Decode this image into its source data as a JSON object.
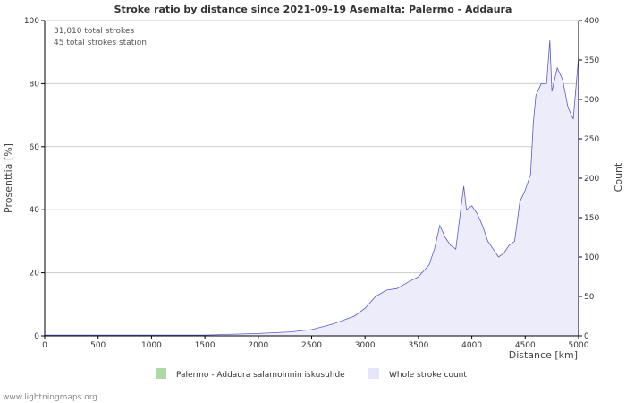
{
  "chart_data": {
    "type": "area",
    "title": "Stroke ratio by distance since 2021-09-19 Asemalta: Palermo - Addaura",
    "xlabel": "Distance   [km]",
    "ylabel_left": "Prosenttia   [%]",
    "ylabel_right": "Count",
    "xlim": [
      0,
      5000
    ],
    "ylim_left": [
      0,
      100
    ],
    "ylim_right": [
      0,
      400
    ],
    "x_ticks": [
      "0",
      "500",
      "1000",
      "1500",
      "2000",
      "2500",
      "3000",
      "3500",
      "4000",
      "4500",
      "5000"
    ],
    "y_left_ticks": [
      "0",
      "20",
      "40",
      "60",
      "80",
      "100"
    ],
    "y_right_ticks": [
      "0",
      "50",
      "100",
      "150",
      "200",
      "250",
      "300",
      "350",
      "400"
    ],
    "grid": true,
    "annotations": [
      "31,010 total strokes",
      "45 total strokes station"
    ],
    "legend": [
      {
        "name": "Palermo - Addaura salamoinnin iskusuhde",
        "color": "#aed9a6"
      },
      {
        "name": "Whole stroke count",
        "color": "#e6e6f8"
      }
    ],
    "series": [
      {
        "name": "Whole stroke count",
        "axis": "right",
        "x": [
          0,
          500,
          1000,
          1500,
          2000,
          2300,
          2500,
          2700,
          2800,
          2900,
          3000,
          3100,
          3200,
          3300,
          3400,
          3500,
          3600,
          3650,
          3700,
          3750,
          3800,
          3850,
          3900,
          3925,
          3950,
          4000,
          4050,
          4100,
          4150,
          4200,
          4250,
          4300,
          4350,
          4400,
          4450,
          4500,
          4550,
          4575,
          4600,
          4650,
          4700,
          4730,
          4750,
          4800,
          4850,
          4900,
          4950,
          5000
        ],
        "values": [
          1,
          1,
          1,
          1,
          3,
          5,
          8,
          15,
          20,
          25,
          35,
          50,
          58,
          60,
          68,
          75,
          90,
          110,
          140,
          125,
          115,
          110,
          165,
          190,
          160,
          165,
          155,
          140,
          120,
          110,
          100,
          105,
          115,
          120,
          170,
          185,
          205,
          270,
          305,
          320,
          320,
          375,
          310,
          340,
          325,
          290,
          275,
          355
        ]
      }
    ]
  },
  "footer": "www.lightningmaps.org",
  "colors": {
    "area_fill": "#ececfa",
    "line": "#5a5ad0",
    "grid": "#cccccc",
    "axis": "#000000"
  }
}
